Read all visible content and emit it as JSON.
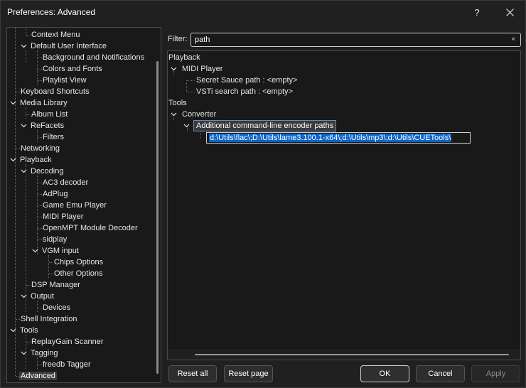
{
  "window": {
    "title": "Preferences: Advanced",
    "help_label": "?",
    "close_label": "✕"
  },
  "tree": {
    "items": [
      {
        "label": "Context Menu"
      },
      {
        "label": "Default User Interface"
      },
      {
        "label": "Background and Notifications"
      },
      {
        "label": "Colors and Fonts"
      },
      {
        "label": "Playlist View"
      },
      {
        "label": "Keyboard Shortcuts"
      },
      {
        "label": "Media Library"
      },
      {
        "label": "Album List"
      },
      {
        "label": "ReFacets"
      },
      {
        "label": "Filters"
      },
      {
        "label": "Networking"
      },
      {
        "label": "Playback"
      },
      {
        "label": "Decoding"
      },
      {
        "label": "AC3 decoder"
      },
      {
        "label": "AdPlug"
      },
      {
        "label": "Game Emu Player"
      },
      {
        "label": "MIDI Player"
      },
      {
        "label": "OpenMPT Module Decoder"
      },
      {
        "label": "sidplay"
      },
      {
        "label": "VGM input"
      },
      {
        "label": "Chips Options"
      },
      {
        "label": "Other Options"
      },
      {
        "label": "DSP Manager"
      },
      {
        "label": "Output"
      },
      {
        "label": "Devices"
      },
      {
        "label": "Shell Integration"
      },
      {
        "label": "Tools"
      },
      {
        "label": "ReplayGain Scanner"
      },
      {
        "label": "Tagging"
      },
      {
        "label": "freedb Tagger"
      },
      {
        "label": "Advanced"
      }
    ]
  },
  "filter": {
    "label": "Filter:",
    "value": "path",
    "clear_icon": "×"
  },
  "props": {
    "playback": "Playback",
    "midi_player": "MIDI Player",
    "secret_sauce": "Secret Sauce path : <empty>",
    "vsti_search": "VSTi search path : <empty>",
    "tools": "Tools",
    "converter": "Converter",
    "encoder_paths": "Additional command-line encoder paths",
    "encoder_value": "d:\\Utils\\flac\\;D:\\Utils\\lame3.100.1-x64\\;d:\\Utils\\mp3\\;d:\\Utils\\CUETools\\"
  },
  "buttons": {
    "reset_all": "Reset all",
    "reset_page": "Reset page",
    "ok": "OK",
    "cancel": "Cancel",
    "apply": "Apply"
  }
}
